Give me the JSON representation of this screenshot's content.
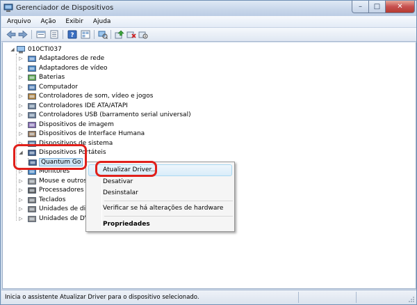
{
  "window": {
    "title": "Gerenciador de Dispositivos"
  },
  "menubar": {
    "items": [
      "Arquivo",
      "Ação",
      "Exibir",
      "Ajuda"
    ]
  },
  "toolbar": {
    "buttons": [
      "back-icon",
      "forward-icon",
      "up-level-icon",
      "properties-sheet-icon",
      "help-icon",
      "view-icon",
      "scan-hardware-icon",
      "update-driver-icon",
      "uninstall-icon",
      "disable-icon"
    ]
  },
  "tree": {
    "root": "010CTI037",
    "items": [
      "Adaptadores de rede",
      "Adaptadores de vídeo",
      "Baterias",
      "Computador",
      "Controladores de som, vídeo e jogos",
      "Controladores IDE ATA/ATAPI",
      "Controladores USB (barramento serial universal)",
      "Dispositivos de imagem",
      "Dispositivos de Interface Humana",
      "Dispositivos de sistema",
      "Dispositivos Portáteis",
      "Quantum Go",
      "Monitores",
      "Mouse e outros d",
      "Processadores",
      "Teclados",
      "Unidades de disco",
      "Unidades de DVD"
    ]
  },
  "context_menu": {
    "items": [
      "Atualizar Driver...",
      "Desativar",
      "Desinstalar",
      "Verificar se há alterações de hardware",
      "Propriedades"
    ]
  },
  "statusbar": {
    "text": "Inicia o assistente Atualizar Driver para o dispositivo selecionado."
  },
  "colors": {
    "highlight_ring": "#e0201b",
    "accent": "#6f8fb4"
  }
}
